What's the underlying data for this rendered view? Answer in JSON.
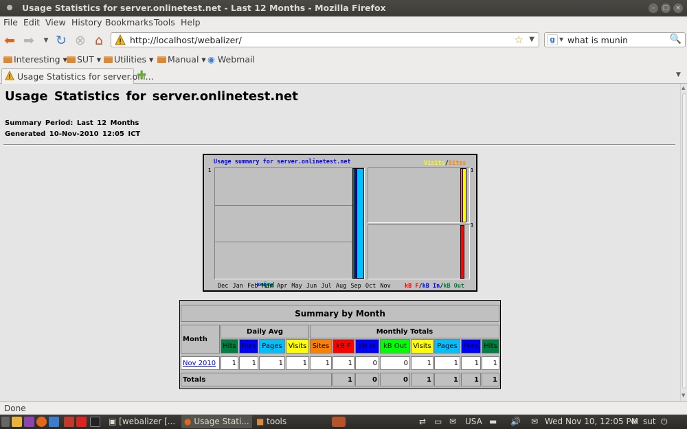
{
  "window": {
    "title": "Usage Statistics for server.onlinetest.net - Last 12 Months - Mozilla Firefox"
  },
  "menu": [
    "File",
    "Edit",
    "View",
    "History",
    "Bookmarks",
    "Tools",
    "Help"
  ],
  "nav": {
    "url": "http://localhost/webalizer/",
    "search_value": "what is munin"
  },
  "bookmarks": [
    "Interesting",
    "SUT",
    "Utilities",
    "Manual",
    "Webmail"
  ],
  "tab": {
    "label": "Usage Statistics for server.onl..."
  },
  "page": {
    "title": "Usage Statistics for server.onlinetest.net",
    "period": "Summary Period: Last 12 Months",
    "generated": "Generated 10-Nov-2010 12:05 ICT"
  },
  "graph": {
    "title": "Usage summary for server.onlinetest.net",
    "legend_visits": "Visits",
    "legend_sites": "Sites",
    "legend_sep": "/",
    "ylabel_pages": "Pages",
    "ylabel_files": "Files",
    "ylabel_hits": "Hits",
    "legend_kbf": "kB F",
    "legend_kbin": "kB In",
    "legend_kbout": "kB Out",
    "ymax": "1"
  },
  "chart_data": {
    "type": "bar",
    "title": "Usage summary for server.onlinetest.net",
    "categories": [
      "Dec",
      "Jan",
      "Feb",
      "Mar",
      "Apr",
      "May",
      "Jun",
      "Jul",
      "Aug",
      "Sep",
      "Oct",
      "Nov"
    ],
    "series": [
      {
        "name": "Hits",
        "values": [
          0,
          0,
          0,
          0,
          0,
          0,
          0,
          0,
          0,
          0,
          0,
          1
        ]
      },
      {
        "name": "Files",
        "values": [
          0,
          0,
          0,
          0,
          0,
          0,
          0,
          0,
          0,
          0,
          0,
          1
        ]
      },
      {
        "name": "Pages",
        "values": [
          0,
          0,
          0,
          0,
          0,
          0,
          0,
          0,
          0,
          0,
          0,
          1
        ]
      },
      {
        "name": "Visits",
        "values": [
          0,
          0,
          0,
          0,
          0,
          0,
          0,
          0,
          0,
          0,
          0,
          1
        ]
      },
      {
        "name": "Sites",
        "values": [
          0,
          0,
          0,
          0,
          0,
          0,
          0,
          0,
          0,
          0,
          0,
          1
        ]
      },
      {
        "name": "kB F",
        "values": [
          0,
          0,
          0,
          0,
          0,
          0,
          0,
          0,
          0,
          0,
          0,
          1
        ]
      },
      {
        "name": "kB In",
        "values": [
          0,
          0,
          0,
          0,
          0,
          0,
          0,
          0,
          0,
          0,
          0,
          0
        ]
      },
      {
        "name": "kB Out",
        "values": [
          0,
          0,
          0,
          0,
          0,
          0,
          0,
          0,
          0,
          0,
          0,
          0
        ]
      }
    ],
    "ylim": [
      0,
      1
    ],
    "grid": true,
    "colors": {
      "hits": "#008040",
      "files": "#0000ff",
      "pages": "#00c0ff",
      "visits": "#ffff00",
      "sites": "#ff8000",
      "kbf": "#ff0000"
    }
  },
  "summary": {
    "title": "Summary by Month",
    "month_header": "Month",
    "daily_avg": "Daily Avg",
    "monthly_totals": "Monthly Totals",
    "cols_daily": [
      "Hits",
      "Files",
      "Pages",
      "Visits"
    ],
    "cols_monthly": [
      "Sites",
      "kB F",
      "kB In",
      "kB Out",
      "Visits",
      "Pages",
      "Files",
      "Hits"
    ],
    "rows": [
      {
        "month": "Nov 2010",
        "daily": [
          "1",
          "1",
          "1",
          "1"
        ],
        "monthly": [
          "1",
          "1",
          "0",
          "0",
          "1",
          "1",
          "1",
          "1"
        ]
      }
    ],
    "totals_label": "Totals",
    "totals": [
      "1",
      "0",
      "0",
      "1",
      "1",
      "1",
      "1"
    ]
  },
  "status": {
    "text": "Done"
  },
  "taskbar": {
    "tasks": [
      "[webalizer [...",
      "Usage Stati...",
      "tools"
    ],
    "keyboard": "USA",
    "clock": "Wed Nov 10, 12:05 PM",
    "user": "sut"
  }
}
